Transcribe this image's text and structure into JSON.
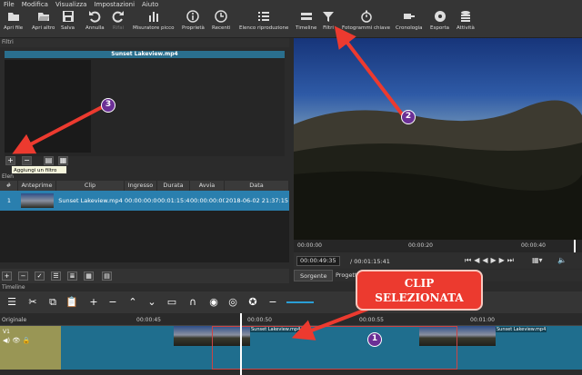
{
  "menu": [
    "File",
    "Modifica",
    "Visualizza",
    "Impostazioni",
    "Aiuto"
  ],
  "toolbar": {
    "items": [
      {
        "label": "Apri file",
        "icon": "folder-icon"
      },
      {
        "label": "Apri altro",
        "icon": "folder-open-icon"
      },
      {
        "label": "Salva",
        "icon": "save-icon"
      },
      {
        "label": "Annulla",
        "icon": "undo-icon"
      },
      {
        "label": "Rifai",
        "icon": "redo-icon"
      },
      {
        "label": "Misuratore picco",
        "icon": "meter-icon"
      },
      {
        "label": "Proprietà",
        "icon": "info-icon"
      },
      {
        "label": "Recenti",
        "icon": "clock-icon"
      },
      {
        "label": "Elenco riproduzione",
        "icon": "list-icon"
      },
      {
        "label": "Timeline",
        "icon": "timeline-icon"
      },
      {
        "label": "Filtri",
        "icon": "filter-icon"
      },
      {
        "label": "Fotogrammi chiave",
        "icon": "stopwatch-icon"
      },
      {
        "label": "Cronologia",
        "icon": "history-icon"
      },
      {
        "label": "Esporta",
        "icon": "export-icon"
      },
      {
        "label": "Attività",
        "icon": "jobs-icon"
      }
    ]
  },
  "filters": {
    "title": "Filtri",
    "clip_name": "Sunset Lakeview.mp4",
    "tooltip": "Aggiungi un filtro"
  },
  "playlist": {
    "title": "Elen",
    "columns": [
      "#",
      "Anteprime",
      "Clip",
      "Ingresso",
      "Durata",
      "Avvia",
      "Data"
    ],
    "rows": [
      {
        "num": "1",
        "clip": "Sunset Lakeview.mp4",
        "ingresso": "00:00:00:00",
        "durata": "00:01:15:41",
        "avvia": "00:00:00:00",
        "data": "2018-06-02 21:37:15"
      }
    ]
  },
  "viewer": {
    "ruler": [
      "00:00:00",
      "00:00:20",
      "00:00:40"
    ],
    "current": "00:00:49:35",
    "total": "/ 00:01:15:41"
  },
  "tabs": [
    "Sorgente",
    "Progetto"
  ],
  "timeline": {
    "title": "Timeline",
    "ruler": [
      "00:00:45",
      "00:00:50",
      "00:00:55",
      "00:01:00"
    ],
    "track_original": "Originale",
    "track_v1": "V1",
    "clip_label": "Sunset Lakeview.mp4"
  },
  "annotations": {
    "callout": "CLIP SELEZIONATA",
    "callout_line1": "CLIP",
    "callout_line2": "SELEZIONATA",
    "num1": "1",
    "num2": "2",
    "num3": "3"
  },
  "colors": {
    "arrow": "#ec3a2f",
    "callout": "#ec3a2f",
    "selection": "#2a7fae",
    "badge": "#6b2f95"
  }
}
